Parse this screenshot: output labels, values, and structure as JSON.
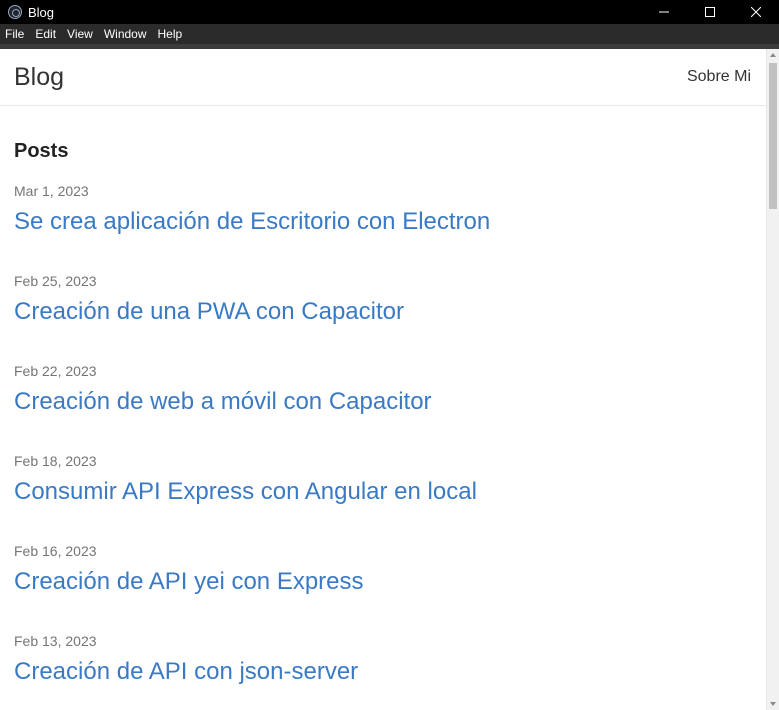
{
  "window": {
    "title": "Blog",
    "controls": [
      "minimize-icon",
      "maximize-icon",
      "close-icon"
    ]
  },
  "menu": {
    "items": [
      "File",
      "Edit",
      "View",
      "Window",
      "Help"
    ]
  },
  "site": {
    "brand": "Blog",
    "nav": {
      "about": "Sobre Mi"
    }
  },
  "posts_section": {
    "title": "Posts",
    "posts": [
      {
        "date": "Mar 1, 2023",
        "title": "Se crea aplicación de Escritorio con Electron"
      },
      {
        "date": "Feb 25, 2023",
        "title": "Creación de una PWA con Capacitor"
      },
      {
        "date": "Feb 22, 2023",
        "title": "Creación de web a móvil con Capacitor"
      },
      {
        "date": "Feb 18, 2023",
        "title": "Consumir API Express con Angular en local"
      },
      {
        "date": "Feb 16, 2023",
        "title": "Creación de API yei con Express"
      },
      {
        "date": "Feb 13, 2023",
        "title": "Creación de API con json-server"
      }
    ]
  },
  "colors": {
    "link": "#3a7ac4",
    "date": "#757575",
    "titlebar": "#000000",
    "menubar": "#2b2b2b"
  }
}
